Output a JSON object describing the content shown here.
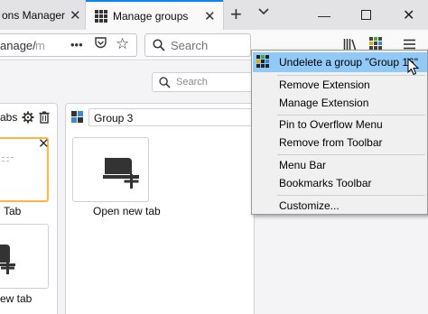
{
  "tabs": [
    {
      "title": "ons Manager"
    },
    {
      "title": "Manage groups"
    }
  ],
  "urlbar": {
    "text_visible": "anage/",
    "text_faded": "m"
  },
  "searchbar": {
    "placeholder": "Search"
  },
  "page": {
    "search_placeholder": "Search",
    "left_group": {
      "name": "abs",
      "tab_label": "Tab",
      "new_tab_label": "ew tab"
    },
    "right_group": {
      "name": "Group 3",
      "new_tab_label": "Open new tab"
    }
  },
  "context_menu": {
    "items": [
      {
        "label": "Undelete a group \"Group 16\"",
        "highlighted": true
      },
      {
        "label": "Remove Extension"
      },
      {
        "label": "Manage Extension"
      },
      {
        "label": "Pin to Overflow Menu"
      },
      {
        "label": "Remove from Toolbar"
      },
      {
        "label": "Menu Bar"
      },
      {
        "label": "Bookmarks Toolbar"
      },
      {
        "label": "Customize..."
      }
    ]
  },
  "colors": {
    "accent": "#0a84ff",
    "highlight": "#91c9f7",
    "selected_card_border": "#ffb547"
  }
}
